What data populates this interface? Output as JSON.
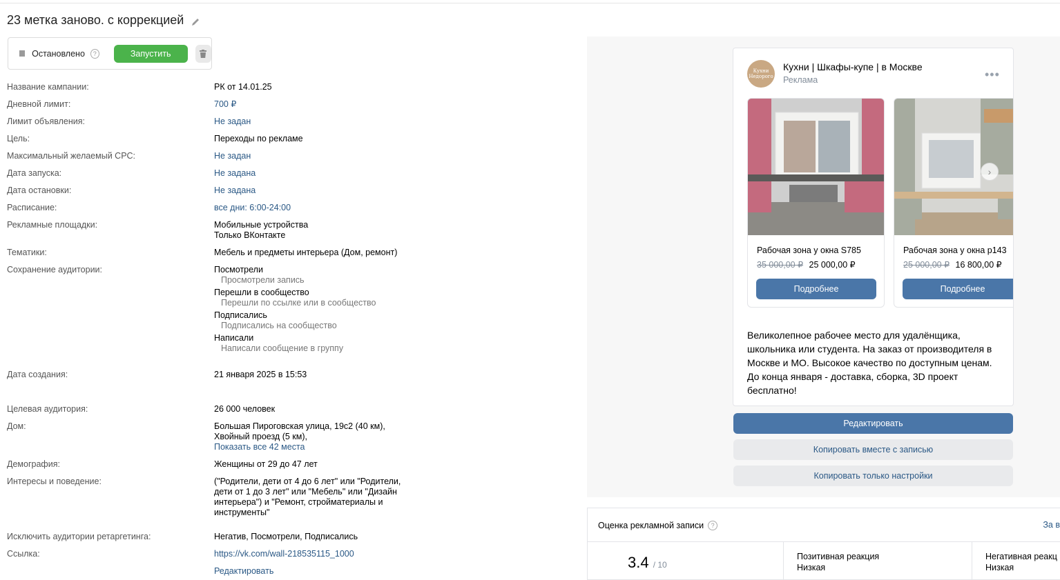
{
  "title": "23 метка заново. с коррекцией",
  "status": {
    "label": "Остановлено",
    "help": "?",
    "run_button": "Запустить"
  },
  "details": {
    "campaign_name": {
      "label": "Название кампании:",
      "value": "РК от 14.01.25"
    },
    "daily_limit": {
      "label": "Дневной лимит:",
      "value": "700 ₽"
    },
    "ad_limit": {
      "label": "Лимит объявления:",
      "value": "Не задан"
    },
    "goal": {
      "label": "Цель:",
      "value": "Переходы по рекламе"
    },
    "max_cpc": {
      "label": "Максимальный желаемый CPC:",
      "value": "Не задан"
    },
    "start_date": {
      "label": "Дата запуска:",
      "value": "Не задана"
    },
    "stop_date": {
      "label": "Дата остановки:",
      "value": "Не задана"
    },
    "schedule": {
      "label": "Расписание:",
      "value": "все дни: 6:00-24:00"
    },
    "platforms": {
      "label": "Рекламные площадки:",
      "line1": "Мобильные устройства",
      "line2": "Только ВКонтакте"
    },
    "topics": {
      "label": "Тематики:",
      "value": "Мебель и предметы интерьера (Дом, ремонт)"
    },
    "audience_saving": {
      "label": "Сохранение аудитории:",
      "groups": [
        {
          "title": "Посмотрели",
          "desc": "Просмотрели запись"
        },
        {
          "title": "Перешли в сообщество",
          "desc": "Перешли по ссылке или в сообщество"
        },
        {
          "title": "Подписались",
          "desc": "Подписались на сообщество"
        },
        {
          "title": "Написали",
          "desc": "Написали сообщение в группу"
        }
      ]
    },
    "created": {
      "label": "Дата создания:",
      "value": "21 января 2025 в 15:53"
    },
    "target_audience": {
      "label": "Целевая аудитория:",
      "value": "26 000 человек"
    },
    "home": {
      "label": "Дом:",
      "line1": "Большая Пироговская улица, 19с2 (40 км),",
      "line2": "Хвойный проезд (5 км),",
      "link": "Показать все 42 места"
    },
    "demography": {
      "label": "Демография:",
      "value": "Женщины от 29 до 47 лет"
    },
    "interests": {
      "label": "Интересы и поведение:",
      "line1": "(\"Родители, дети от 4 до 6 лет\" или \"Родители,",
      "line2": "дети от 1 до 3 лет\" или \"Мебель\" или \"Дизайн",
      "line3": "интерьера\") и \"Ремонт, стройматериалы и",
      "line4": "инструменты\""
    },
    "exclude": {
      "label": "Исключить аудитории ретаргетинга:",
      "value": "Негатив, Посмотрели, Подписались"
    },
    "link": {
      "label": "Ссылка:",
      "value": "https://vk.com/wall-218535115_1000",
      "edit": "Редактировать"
    }
  },
  "post": {
    "avatar_text": "Кухни Недорого",
    "group_name": "Кухни | Шкафы-купе | в Москве",
    "group_sub": "Реклама",
    "more": "•••",
    "cards": [
      {
        "title": "Рабочая зона у окна S785",
        "old_price": "35 000,00 ₽",
        "price": "25 000,00 ₽",
        "button": "Подробнее"
      },
      {
        "title": "Рабочая зона у окна p143",
        "old_price": "25 000,00 ₽",
        "price": "16 800,00 ₽",
        "button": "Подробнее"
      }
    ],
    "text": "Великолепное рабочее место для удалёнщика, школьника или студента. На заказ от производителя в Москве и МО. Высокое качество по доступным ценам. До конца января - доставка, сборка, 3D проект бесплатно!"
  },
  "actions": {
    "edit": "Редактировать",
    "copy_with_post": "Копировать вместе с записью",
    "copy_settings": "Копировать только настройки"
  },
  "rating": {
    "header": "Оценка рекламной записи",
    "help": "?",
    "period": "За в",
    "score": "3.4",
    "score_max": "/ 10",
    "positive_label": "Позитивная реакция",
    "positive_value": "Низкая",
    "negative_label": "Негативная реакц",
    "negative_value": "Низкая"
  },
  "colors": {
    "accent": "#4a76a8",
    "link": "#2a5885",
    "run_green": "#4bb34b"
  }
}
